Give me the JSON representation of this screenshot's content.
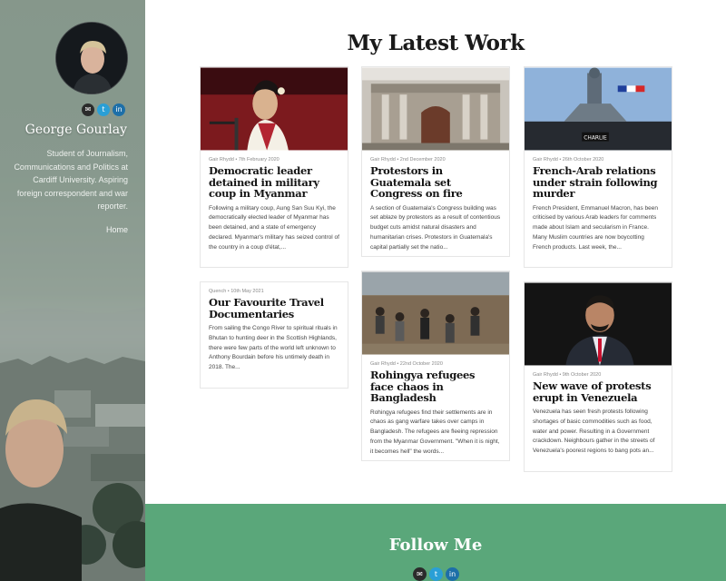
{
  "sidebar": {
    "name": "George Gourlay",
    "bio": "Student of Journalism, Communications and Politics at Cardiff University. Aspiring foreign correspondent and war reporter.",
    "home_link": "Home",
    "social_icons": [
      "mail-icon",
      "twitter-icon",
      "linkedin-icon"
    ]
  },
  "main": {
    "title": "My Latest Work"
  },
  "articles": [
    {
      "meta": "Gair Rhydd • 7th February 2020",
      "title": "Democratic leader detained in military coup in Myanmar",
      "excerpt": "Following a military coup, Aung San Suu Kyi, the democratically elected leader of Myanmar has been detained, and a state of emergency declared. Myanmar's military has seized control of the country in a coup d'état,..."
    },
    {
      "meta": "Gair Rhydd • 2nd December 2020",
      "title": "Protestors in Guatemala set Congress on fire",
      "excerpt": "A section of Guatemala's Congress building was set ablaze by protestors as a result of contentious budget cuts amidst natural disasters and humanitarian crises. Protestors in Guatemala's capital partially set the natio..."
    },
    {
      "meta": "Gair Rhydd • 26th October 2020",
      "title": "French-Arab relations under strain following murder",
      "excerpt": "French President, Emmanuel Macron, has been criticised by various Arab leaders for comments made about Islam and secularism in France. Many Muslim countries are now boycotting French products. Last week, the..."
    },
    {
      "meta": "Quench • 10th May 2021",
      "title": "Our Favourite Travel Documentaries",
      "excerpt": "From sailing the Congo River to spiritual rituals in Bhutan to hunting deer in the Scottish Highlands, there were few parts of the world left unknown to Anthony Bourdain before his untimely death in 2018. The..."
    },
    {
      "meta": "Gair Rhydd • 22nd October 2020",
      "title": "Rohingya refugees face chaos in Bangladesh",
      "excerpt": "Rohingya refugees find their settlements are in chaos as gang warfare takes over camps in Bangladesh. The refugees are fleeing repression from the Myanmar Government. \"When it is night, it becomes hell\" the words..."
    },
    {
      "meta": "Gair Rhydd • 9th October 2020",
      "title": "New wave of protests erupt in Venezuela",
      "excerpt": "Venezuela has seen fresh protests following shortages of basic commodities such as food, water and power. Resulting in a Government crackdown. Neighbours gather in the streets of Venezuela's poorest regions to bang pots an..."
    }
  ],
  "footer": {
    "title": "Follow Me",
    "social_icons": [
      "mail-icon",
      "twitter-icon",
      "linkedin-icon"
    ]
  }
}
